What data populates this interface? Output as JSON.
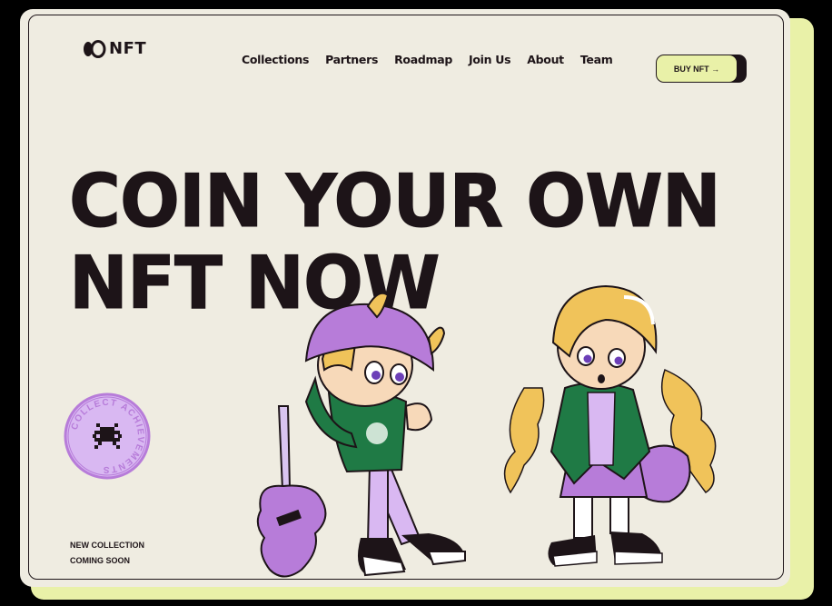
{
  "brand": {
    "name": "NFT"
  },
  "nav": {
    "items": [
      {
        "label": "Collections"
      },
      {
        "label": "Partners"
      },
      {
        "label": "Roadmap"
      },
      {
        "label": "Join Us"
      },
      {
        "label": "About"
      },
      {
        "label": "Team"
      }
    ]
  },
  "cta": {
    "buy_label": "BUY NFT →"
  },
  "hero": {
    "line1": "COIN YOUR OWN",
    "line2": "NFT NOW"
  },
  "badge": {
    "text": "COLLECT ACHIEVEMENTS"
  },
  "footer_note": {
    "line1": "NEW COLLECTION",
    "line2": "COMING SOON"
  },
  "colors": {
    "background": "#efece1",
    "accent_lime": "#e9f1a8",
    "ink": "#1d1418",
    "purple": "#b77cd9",
    "green": "#1f7a45",
    "blonde": "#f0c35a"
  }
}
